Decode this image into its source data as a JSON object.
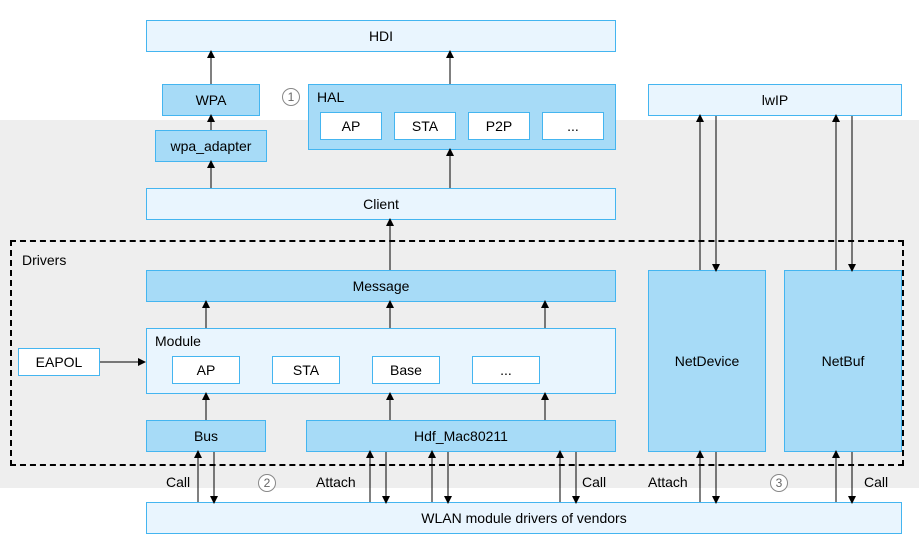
{
  "blocks": {
    "hdi": "HDI",
    "wpa": "WPA",
    "hal_title": "HAL",
    "hal_items": [
      "AP",
      "STA",
      "P2P",
      "..."
    ],
    "wpa_adapter": "wpa_adapter",
    "lwip": "lwIP",
    "client": "Client",
    "drivers_label": "Drivers",
    "message": "Message",
    "eapol": "EAPOL",
    "module_title": "Module",
    "module_items": [
      "AP",
      "STA",
      "Base",
      "..."
    ],
    "bus": "Bus",
    "hdf_mac": "Hdf_Mac80211",
    "netdevice": "NetDevice",
    "netbuf": "NetBuf",
    "vendors": "WLAN module drivers of vendors"
  },
  "edge_labels": {
    "call_a": "Call",
    "attach_a": "Attach",
    "call_b": "Call",
    "attach_b": "Attach",
    "call_c": "Call"
  },
  "annotations": {
    "n1": "1",
    "n2": "2",
    "n3": "3"
  },
  "colors": {
    "container_light": "#e9f5fe",
    "fill_mid": "#a7dbf7",
    "border": "#44b5f0",
    "gray": "#eeeeee"
  }
}
